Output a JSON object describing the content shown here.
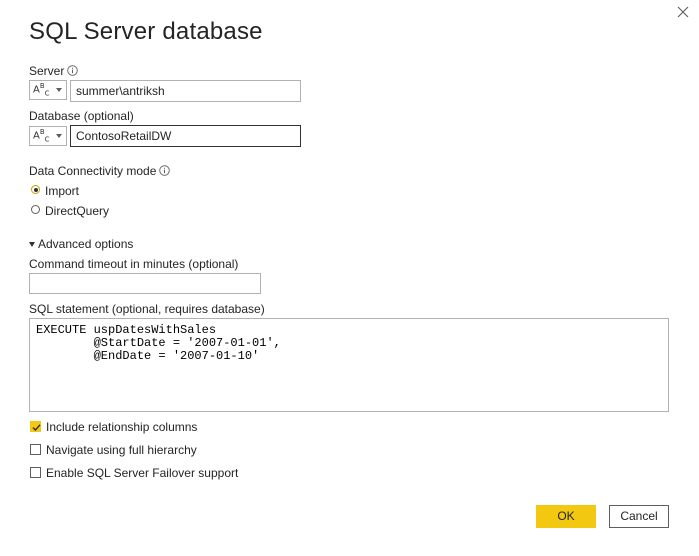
{
  "dialog": {
    "title": "SQL Server database"
  },
  "server": {
    "label": "Server",
    "value": "summer\\antriksh",
    "type_icon": "abc-text-icon"
  },
  "database": {
    "label": "Database (optional)",
    "value": "ContosoRetailDW",
    "type_icon": "abc-text-icon"
  },
  "connectivity": {
    "label": "Data Connectivity mode",
    "options": [
      {
        "label": "Import",
        "selected": true
      },
      {
        "label": "DirectQuery",
        "selected": false
      }
    ]
  },
  "advanced": {
    "toggle_label": "Advanced options",
    "timeout_label": "Command timeout in minutes (optional)",
    "timeout_value": "",
    "sql_label": "SQL statement (optional, requires database)",
    "sql_value": "EXECUTE uspDatesWithSales\n        @StartDate = '2007-01-01',\n        @EndDate = '2007-01-10'"
  },
  "options": [
    {
      "label": "Include relationship columns",
      "checked": true
    },
    {
      "label": "Navigate using full hierarchy",
      "checked": false
    },
    {
      "label": "Enable SQL Server Failover support",
      "checked": false
    }
  ],
  "buttons": {
    "ok": "OK",
    "cancel": "Cancel"
  },
  "colors": {
    "accent": "#f2c811",
    "text": "#252423",
    "border": "#b3b0ad"
  }
}
